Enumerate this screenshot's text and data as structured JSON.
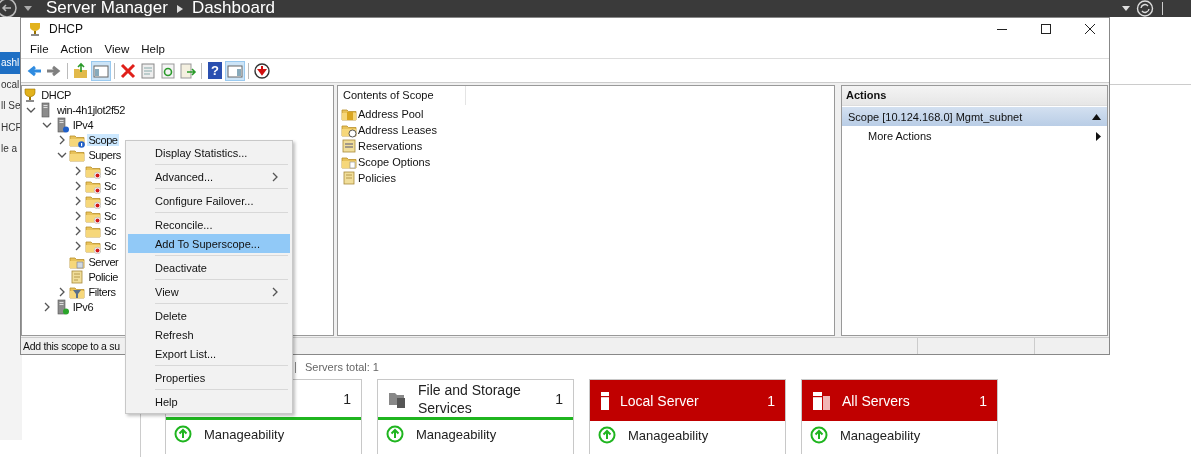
{
  "server_manager": {
    "title": "Server Manager",
    "page": "Dashboard",
    "sidebar": [
      {
        "label": "ashl",
        "selected": true
      },
      {
        "label": "ocal",
        "selected": false
      },
      {
        "label": "ll Se",
        "selected": false
      },
      {
        "label": "HCF",
        "selected": false
      },
      {
        "label": "le a",
        "selected": false
      }
    ],
    "servers_total": "Servers total: 1",
    "tiles": [
      {
        "kind": "roles",
        "count": "1",
        "alert": false,
        "metrics": [
          "Manageability"
        ]
      },
      {
        "kind": "file-storage",
        "title": "File and Storage Services",
        "count": "1",
        "alert": false,
        "metrics": [
          "Manageability"
        ]
      },
      {
        "kind": "local-server",
        "title": "Local Server",
        "count": "1",
        "alert": true,
        "metrics": [
          "Manageability"
        ]
      },
      {
        "kind": "all-servers",
        "title": "All Servers",
        "count": "1",
        "alert": true,
        "metrics": [
          "Manageability"
        ]
      }
    ]
  },
  "dhcp": {
    "title": "DHCP",
    "menu": [
      "File",
      "Action",
      "View",
      "Help"
    ],
    "toolbar": [
      {
        "kind": "back",
        "pressed": false
      },
      {
        "kind": "forward",
        "pressed": false
      },
      {
        "kind": "separator"
      },
      {
        "kind": "up",
        "pressed": false
      },
      {
        "kind": "console-tree",
        "pressed": true
      },
      {
        "kind": "separator"
      },
      {
        "kind": "delete",
        "pressed": false
      },
      {
        "kind": "properties",
        "pressed": false
      },
      {
        "kind": "refresh",
        "pressed": false
      },
      {
        "kind": "export",
        "pressed": false
      },
      {
        "kind": "separator"
      },
      {
        "kind": "help",
        "glyph": "?",
        "pressed": false
      },
      {
        "kind": "action-pane",
        "pressed": true
      },
      {
        "kind": "separator"
      },
      {
        "kind": "stop",
        "pressed": false
      }
    ],
    "tree": [
      {
        "label": "DHCP",
        "kind": "dhcp",
        "selected": false,
        "children": [
          {
            "label": "win-4h1jlot2f52",
            "kind": "server",
            "expanded": true,
            "selected": false,
            "children": [
              {
                "label": "IPv4",
                "kind": "ipv4",
                "expanded": true,
                "selected": false,
                "children": [
                  {
                    "label": "Scope",
                    "kind": "scope",
                    "info": true,
                    "deactivated": false,
                    "expanded": false,
                    "selected": true
                  },
                  {
                    "label": "Supers",
                    "kind": "superscope",
                    "expanded": true,
                    "selected": false,
                    "children": [
                      {
                        "label": "Sc",
                        "kind": "scope",
                        "deactivated": true,
                        "expanded": false,
                        "selected": false
                      },
                      {
                        "label": "Sc",
                        "kind": "scope",
                        "deactivated": true,
                        "expanded": false,
                        "selected": false
                      },
                      {
                        "label": "Sc",
                        "kind": "scope",
                        "deactivated": true,
                        "expanded": false,
                        "selected": false
                      },
                      {
                        "label": "Sc",
                        "kind": "scope",
                        "deactivated": true,
                        "expanded": false,
                        "selected": false
                      },
                      {
                        "label": "Sc",
                        "kind": "scope",
                        "deactivated": false,
                        "expanded": false,
                        "selected": false
                      },
                      {
                        "label": "Sc",
                        "kind": "scope",
                        "deactivated": true,
                        "expanded": false,
                        "selected": false
                      }
                    ]
                  },
                  {
                    "label": "Server",
                    "kind": "options",
                    "selected": false
                  },
                  {
                    "label": "Policie",
                    "kind": "policies",
                    "selected": false
                  },
                  {
                    "label": "Filters",
                    "kind": "filters",
                    "expanded": false,
                    "selected": false
                  }
                ]
              },
              {
                "label": "IPv6",
                "kind": "ipv6",
                "expanded": false,
                "selected": false
              }
            ]
          }
        ]
      }
    ],
    "contents": {
      "column": "Contents of Scope",
      "items": [
        {
          "label": "Address Pool",
          "kind": "pool"
        },
        {
          "label": "Address Leases",
          "kind": "leases"
        },
        {
          "label": "Reservations",
          "kind": "reservations"
        },
        {
          "label": "Scope Options",
          "kind": "options"
        },
        {
          "label": "Policies",
          "kind": "policies"
        }
      ]
    },
    "actions": {
      "title": "Actions",
      "section": "Scope [10.124.168.0] Mgmt_subnet",
      "expanded": true,
      "items": [
        {
          "label": "More Actions",
          "submenu": true
        }
      ]
    },
    "status": "Add this scope to a su"
  },
  "context_menu": [
    [
      {
        "label": "Display Statistics...",
        "submenu": false,
        "selected": false
      }
    ],
    [
      {
        "label": "Advanced...",
        "submenu": true,
        "selected": false
      }
    ],
    [
      {
        "label": "Configure Failover...",
        "submenu": false,
        "selected": false
      }
    ],
    [
      {
        "label": "Reconcile...",
        "submenu": false,
        "selected": false
      },
      {
        "label": "Add To Superscope...",
        "submenu": false,
        "selected": true
      }
    ],
    [
      {
        "label": "Deactivate",
        "submenu": false,
        "selected": false
      }
    ],
    [
      {
        "label": "View",
        "submenu": true,
        "selected": false
      }
    ],
    [
      {
        "label": "Delete",
        "submenu": false,
        "selected": false
      },
      {
        "label": "Refresh",
        "submenu": false,
        "selected": false
      },
      {
        "label": "Export List...",
        "submenu": false,
        "selected": false
      }
    ],
    [
      {
        "label": "Properties",
        "submenu": false,
        "selected": false
      }
    ],
    [
      {
        "label": "Help",
        "submenu": false,
        "selected": false
      }
    ]
  ]
}
